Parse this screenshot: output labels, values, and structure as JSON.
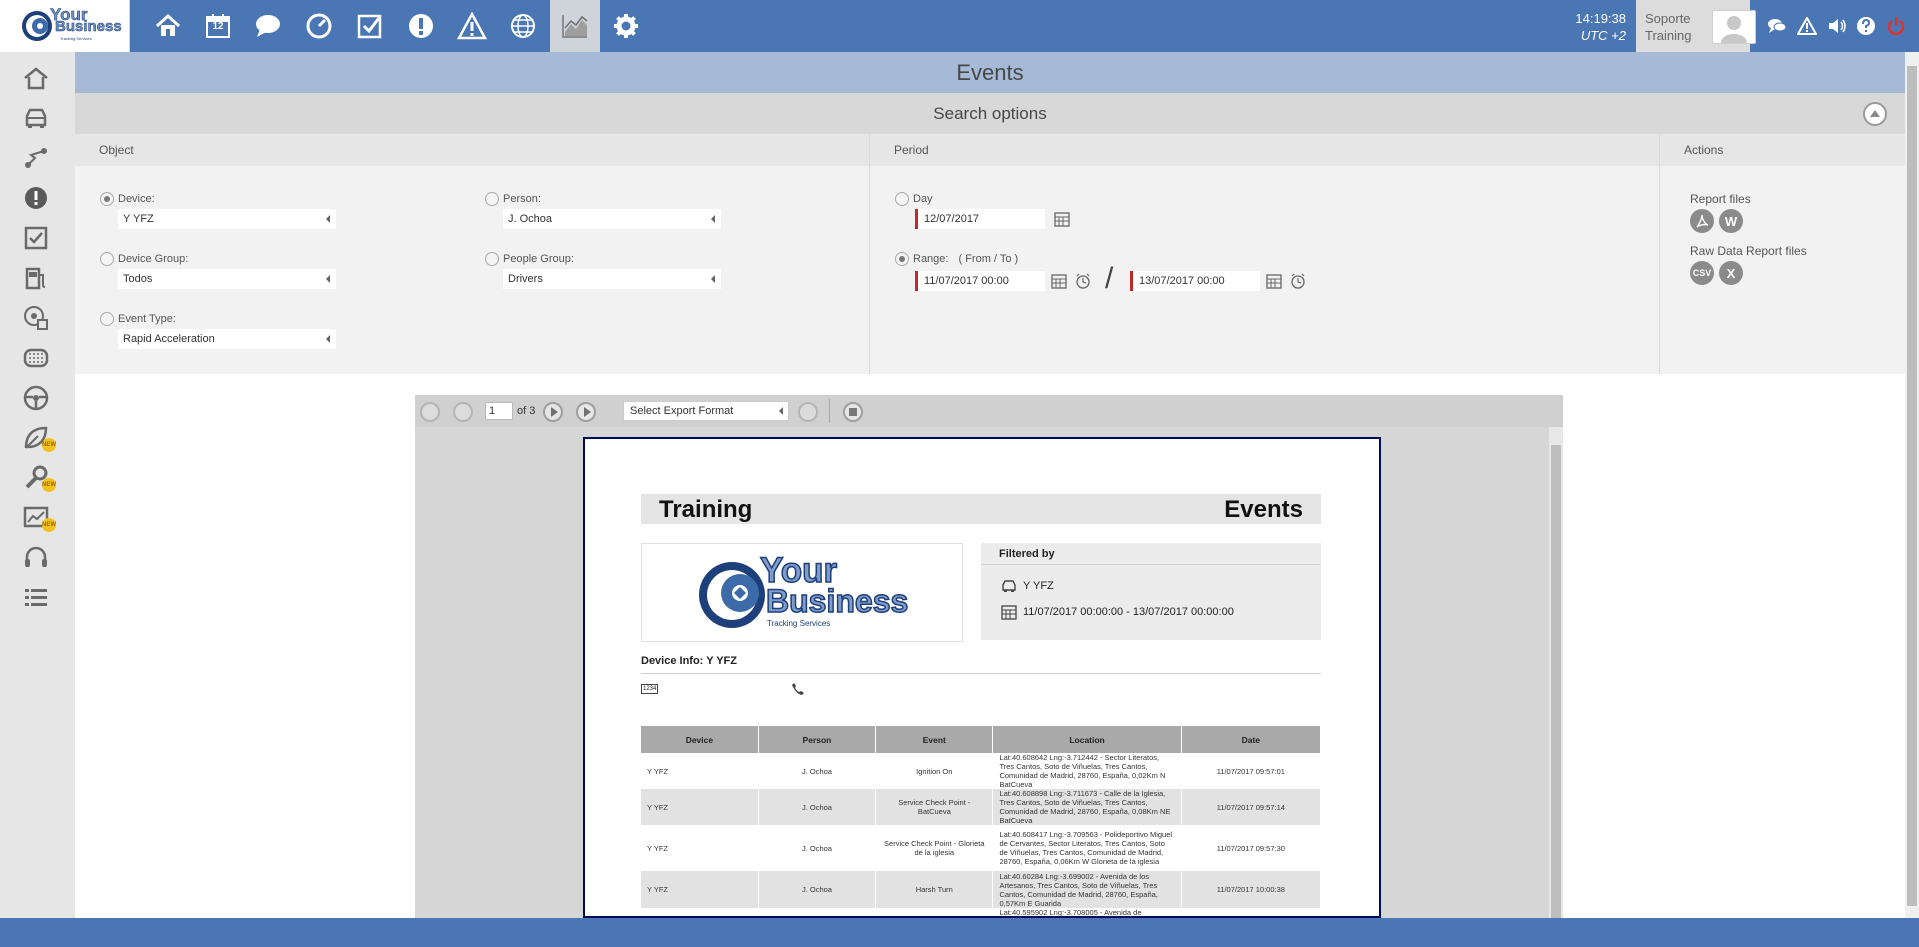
{
  "app": {
    "brand_line1": "Your",
    "brand_line2": "Business",
    "brand_sub": "Tracking Services"
  },
  "topbar": {
    "nav_icons": [
      "home-icon",
      "calendar-icon",
      "chat-icon",
      "dashboard-icon",
      "checklist-icon",
      "alert-icon",
      "warning-icon",
      "globe-icon",
      "reports-chart-icon",
      "settings-icon"
    ],
    "calendar_day": "12",
    "active_nav": "reports-chart-icon",
    "time": "14:19:38",
    "timezone": "UTC +2",
    "user_line1": "Soporte",
    "user_line2": "Training",
    "right_icons": [
      "messages-icon",
      "warning-icon",
      "volume-icon",
      "help-icon",
      "power-icon"
    ]
  },
  "colors": {
    "primary": "#4a77b4",
    "title_bar": "#a6bad8",
    "required_marker": "#c0292b",
    "new_badge": "#f4c21d"
  },
  "sidebar": {
    "items": [
      {
        "icon": "home-icon"
      },
      {
        "icon": "vehicle-icon"
      },
      {
        "icon": "route-icon"
      },
      {
        "icon": "alert-icon"
      },
      {
        "icon": "checklist-icon"
      },
      {
        "icon": "fuel-icon"
      },
      {
        "icon": "geofence-icon"
      },
      {
        "icon": "tire-icon"
      },
      {
        "icon": "steering-wheel-icon"
      },
      {
        "icon": "leaf-icon",
        "badge": "NEW"
      },
      {
        "icon": "maintenance-icon",
        "badge": "NEW"
      },
      {
        "icon": "analytics-icon",
        "badge": "NEW"
      },
      {
        "icon": "support-headset-icon"
      },
      {
        "icon": "list-icon"
      }
    ]
  },
  "page": {
    "title": "Events",
    "search_options_title": "Search options"
  },
  "object_panel": {
    "header": "Object",
    "device_label": "Device:",
    "device_value": "Y YFZ",
    "device_group_label": "Device Group:",
    "device_group_value": "Todos",
    "event_type_label": "Event Type:",
    "event_type_value": "Rapid Acceleration",
    "person_label": "Person:",
    "person_value": "J. Ochoa",
    "people_group_label": "People Group:",
    "people_group_value": "Drivers"
  },
  "period_panel": {
    "header": "Period",
    "day_label": "Day",
    "day_value": "12/07/2017",
    "range_label": "Range:",
    "range_hint": "( From / To )",
    "range_from": "11/07/2017 00:00",
    "range_to": "13/07/2017 00:00",
    "separator": "/"
  },
  "actions_panel": {
    "header": "Actions",
    "report_files_label": "Report files",
    "report_file_buttons": [
      "pdf-icon",
      "W"
    ],
    "raw_files_label": "Raw Data Report files",
    "raw_file_buttons": [
      "CSV",
      "X"
    ]
  },
  "viewer": {
    "page_current": "1",
    "page_total_label": "of 3",
    "export_placeholder": "Select Export Format"
  },
  "report": {
    "title_left": "Training",
    "title_right": "Events",
    "logo_line1": "Your",
    "logo_line2": "Business",
    "logo_sub": "Tracking Services",
    "filtered_by_label": "Filtered by",
    "filter_device": "Y YFZ",
    "filter_period": "11/07/2017 00:00:00 - 13/07/2017 00:00:00",
    "device_info_label": "Device Info: Y YFZ",
    "plate_icon_text": "1234",
    "columns": [
      "Device",
      "Person",
      "Event",
      "Location",
      "Date"
    ],
    "rows": [
      {
        "device": "Y YFZ",
        "person": "J. Ochoa",
        "event": "Ignition On",
        "location": "Lat:40.608642 Lng:-3.712442 - Sector Literatos, Tres Cantos, Soto de Viñuelas, Tres Cantos, Comunidad de Madrid, 28760, España, 0,02Km N BatCueva",
        "date": "11/07/2017 09:57:01"
      },
      {
        "device": "Y YFZ",
        "person": "J. Ochoa",
        "event": "Service Check Point - BatCueva",
        "location": "Lat:40.608898 Lng:-3.711673 - Calle de la Iglesia, Tres Cantos, Soto de Viñuelas, Tres Cantos, Comunidad de Madrid, 28760, España, 0,08Km NE BatCueva",
        "date": "11/07/2017 09:57:14"
      },
      {
        "device": "Y YFZ",
        "person": "J. Ochoa",
        "event": "Service Check Point - Glorieta de la iglesia",
        "location": "Lat:40.608417 Lng:-3.709563 - Polideportivo Miguel de Cervantes, Sector Literatos, Tres Cantos, Soto de Viñuelas, Tres Cantos, Comunidad de Madrid, 28760, España, 0,06Km W Glorieta de la iglesia",
        "date": "11/07/2017 09:57:30"
      },
      {
        "device": "Y YFZ",
        "person": "J. Ochoa",
        "event": "Harsh Turn",
        "location": "Lat:40.60284 Lng:-3.699002 - Avenida de los Artesanos, Tres Cantos, Soto de Viñuelas, Tres Cantos, Comunidad de Madrid, 28760, España, 0,57Km E Guarida",
        "date": "11/07/2017 10:00:38"
      },
      {
        "device": "",
        "person": "",
        "event": "",
        "location": "Lat:40.595902 Lng:-3.708005 - Avenida de",
        "date": ""
      }
    ]
  }
}
